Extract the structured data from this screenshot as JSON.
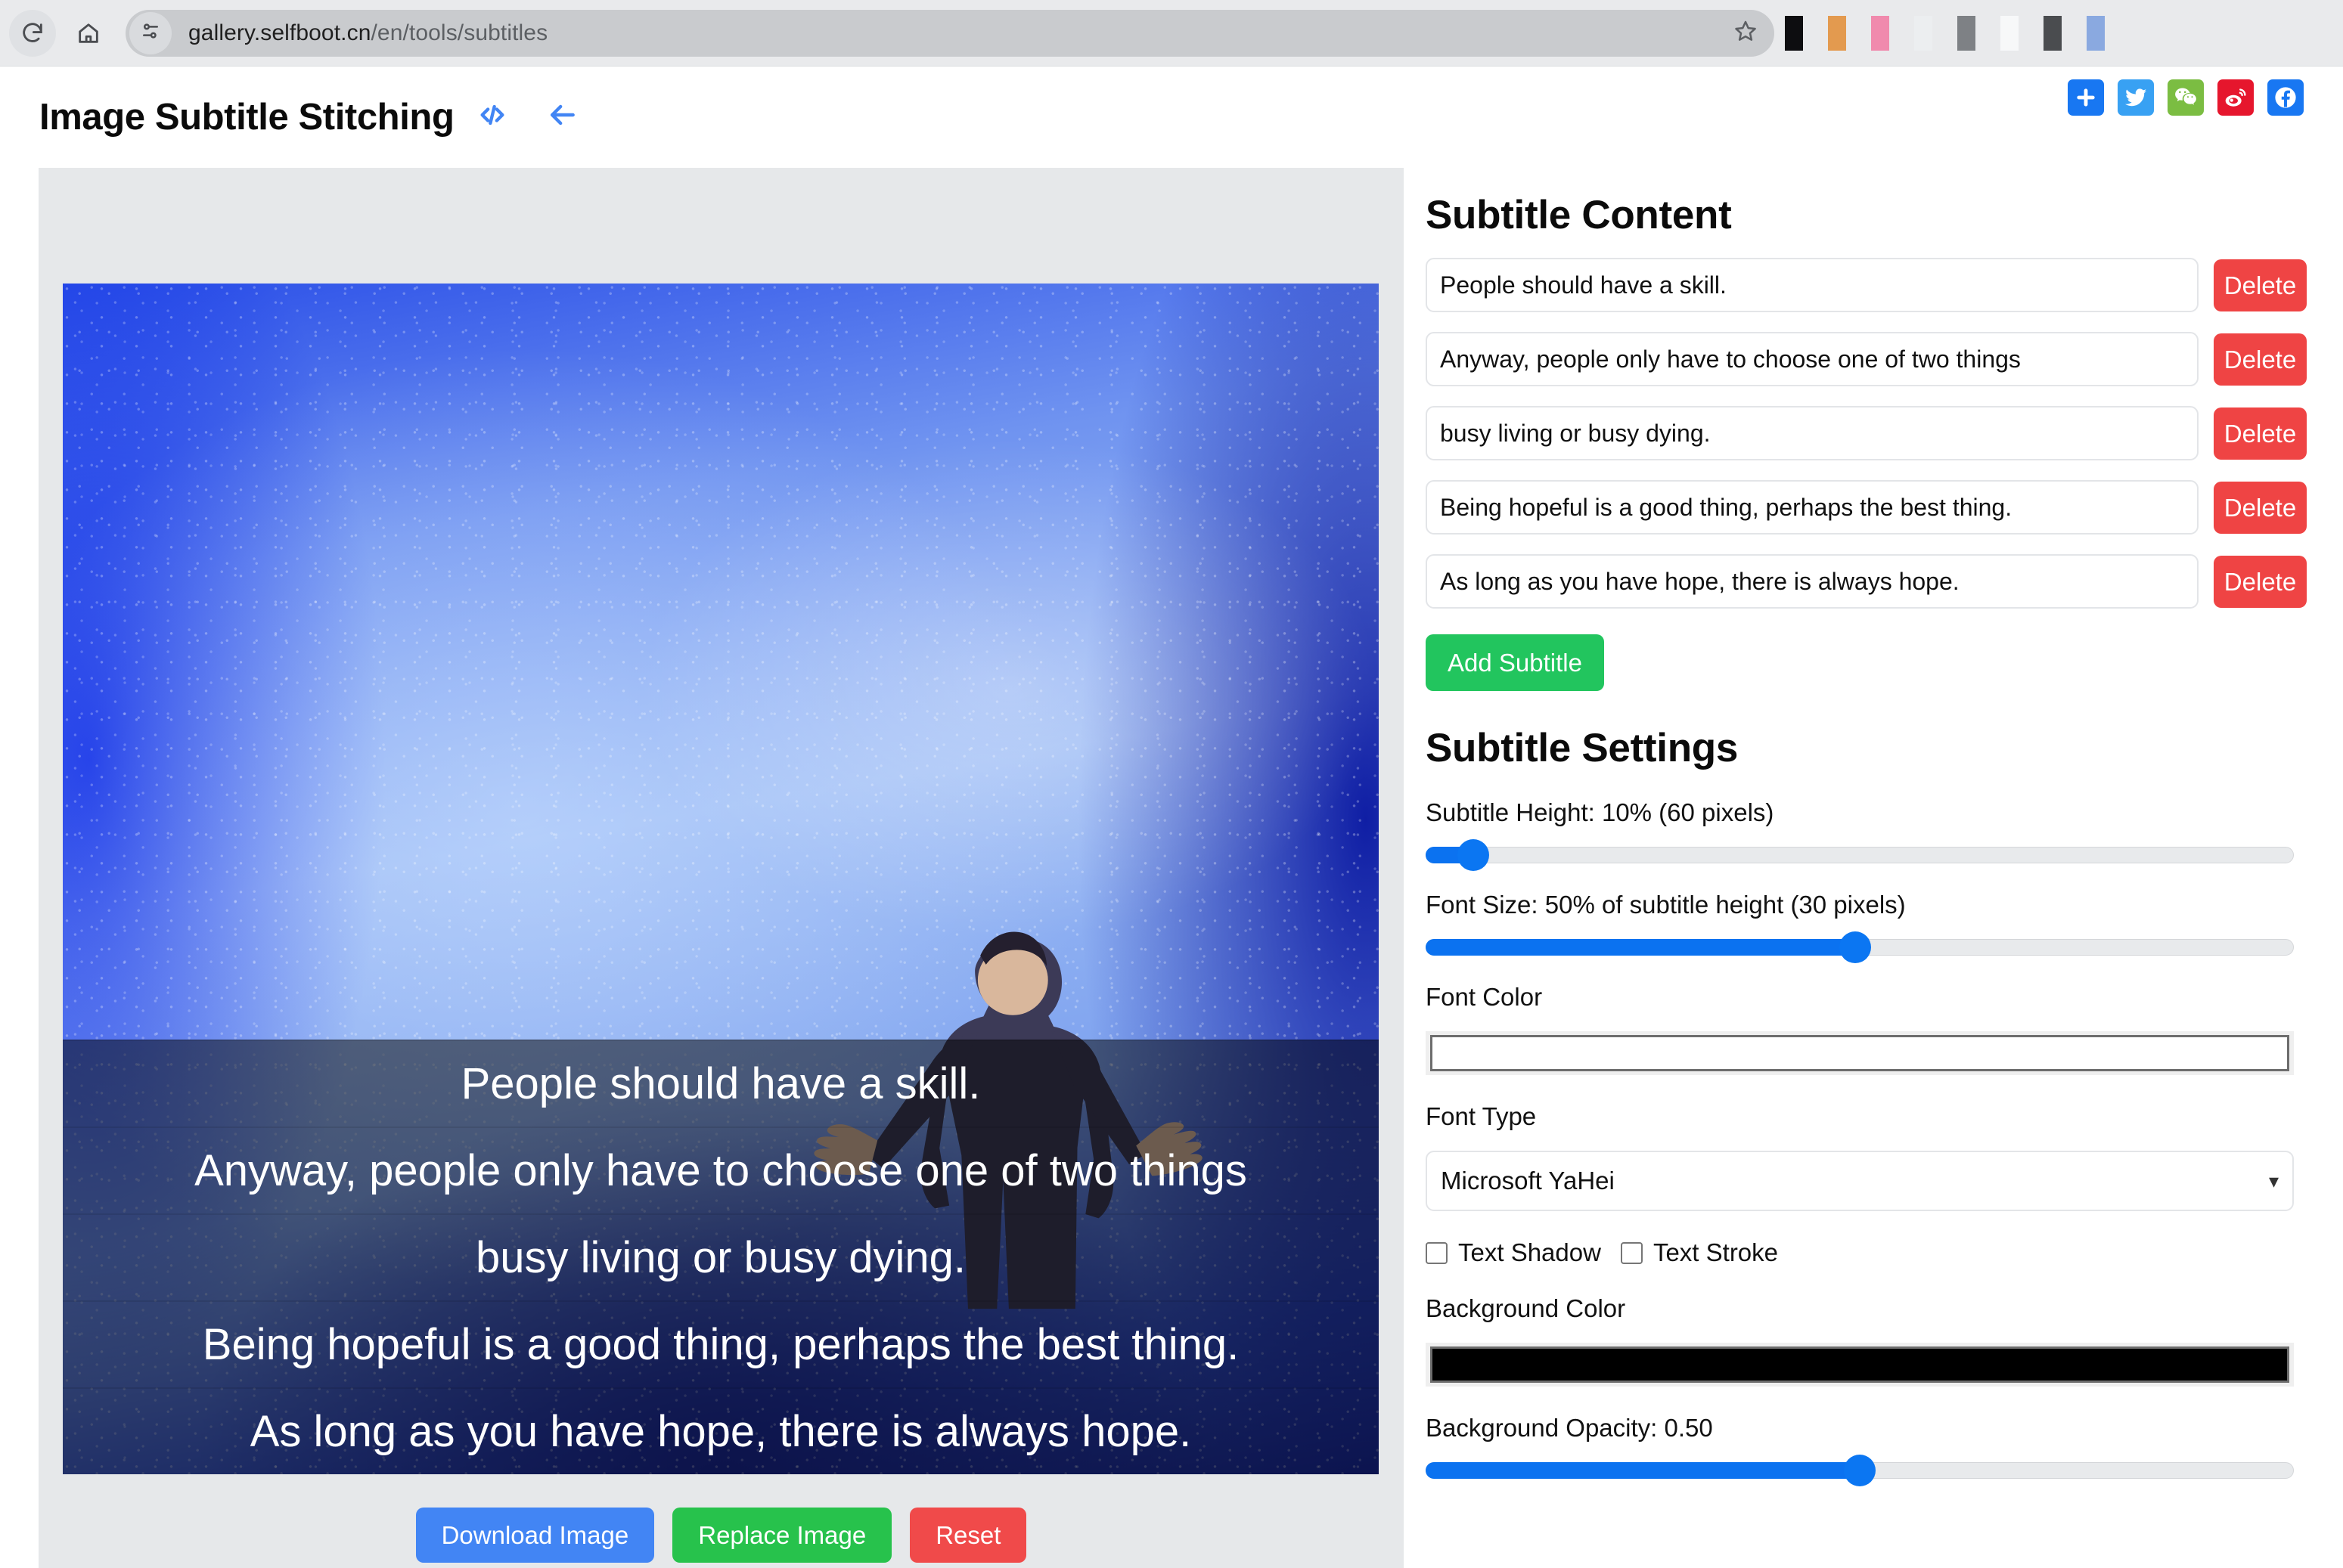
{
  "browser": {
    "url_main": "gallery.selfboot.cn",
    "url_path": "/en/tools/subtitles",
    "reload_icon": "reload-icon",
    "home_icon": "home-icon",
    "site_settings_icon": "site-settings-icon",
    "bookmark_icon": "star-icon",
    "extension_colors": [
      "#0d0d10",
      "#e39a4f",
      "#f08aad",
      "#eceef0",
      "#7e8185",
      "#f7f8f9",
      "#4a4c4f",
      "#8aa9e0"
    ]
  },
  "header": {
    "title": "Image Subtitle Stitching",
    "code_icon": "code-brackets-icon",
    "back_icon": "back-arrow-icon",
    "share": [
      {
        "name": "share-plus",
        "label": "+",
        "color": "#1877f2"
      },
      {
        "name": "share-twitter",
        "label": "Twitter",
        "color": "#38a1f3"
      },
      {
        "name": "share-wechat",
        "label": "WeChat",
        "color": "#7bbd42"
      },
      {
        "name": "share-weibo",
        "label": "Weibo",
        "color": "#e6162d"
      },
      {
        "name": "share-facebook",
        "label": "Facebook",
        "color": "#1877f2"
      }
    ]
  },
  "preview": {
    "image_alt": "man with outstretched arms in the rain",
    "subtitles": [
      "People should have a skill.",
      "Anyway, people only have to choose one of two things",
      "busy living or busy dying.",
      "Being hopeful is a good thing, perhaps the best thing.",
      "As long as you have hope, there is always hope."
    ],
    "actions": {
      "download": "Download Image",
      "replace": "Replace Image",
      "reset": "Reset"
    }
  },
  "subtitle_content": {
    "heading": "Subtitle Content",
    "items": [
      {
        "value": "People should have a skill.",
        "delete_label": "Delete"
      },
      {
        "value": "Anyway, people only have to choose one of two things",
        "delete_label": "Delete"
      },
      {
        "value": "busy living or busy dying.",
        "delete_label": "Delete"
      },
      {
        "value": "Being hopeful is a good thing, perhaps the best thing.",
        "delete_label": "Delete"
      },
      {
        "value": "As long as you have hope, there is always hope.",
        "delete_label": "Delete"
      }
    ],
    "add_label": "Add Subtitle"
  },
  "subtitle_settings": {
    "heading": "Subtitle Settings",
    "subtitle_height": {
      "label": "Subtitle Height: 10% (60 pixels)",
      "percent": 10,
      "pixels": 60,
      "fill_ratio": 5.5
    },
    "font_size": {
      "label": "Font Size: 50% of subtitle height (30 pixels)",
      "percent": 50,
      "pixels": 30,
      "fill_ratio": 49.5
    },
    "font_color": {
      "label": "Font Color",
      "value": "#ffffff"
    },
    "font_type": {
      "label": "Font Type",
      "value": "Microsoft YaHei",
      "chevron": "chevron-down-icon"
    },
    "text_shadow": {
      "label": "Text Shadow",
      "checked": false
    },
    "text_stroke": {
      "label": "Text Stroke",
      "checked": false
    },
    "background_color": {
      "label": "Background Color",
      "value": "#000000"
    },
    "background_opacity": {
      "label": "Background Opacity: 0.50",
      "value": 0.5,
      "fill_ratio": 50
    }
  },
  "colors": {
    "accent_blue": "#0b72f0",
    "danger_red": "#ef4444",
    "success_green": "#22c55e",
    "download_blue": "#4285f4",
    "panel_bg": "#e6e8ea"
  }
}
